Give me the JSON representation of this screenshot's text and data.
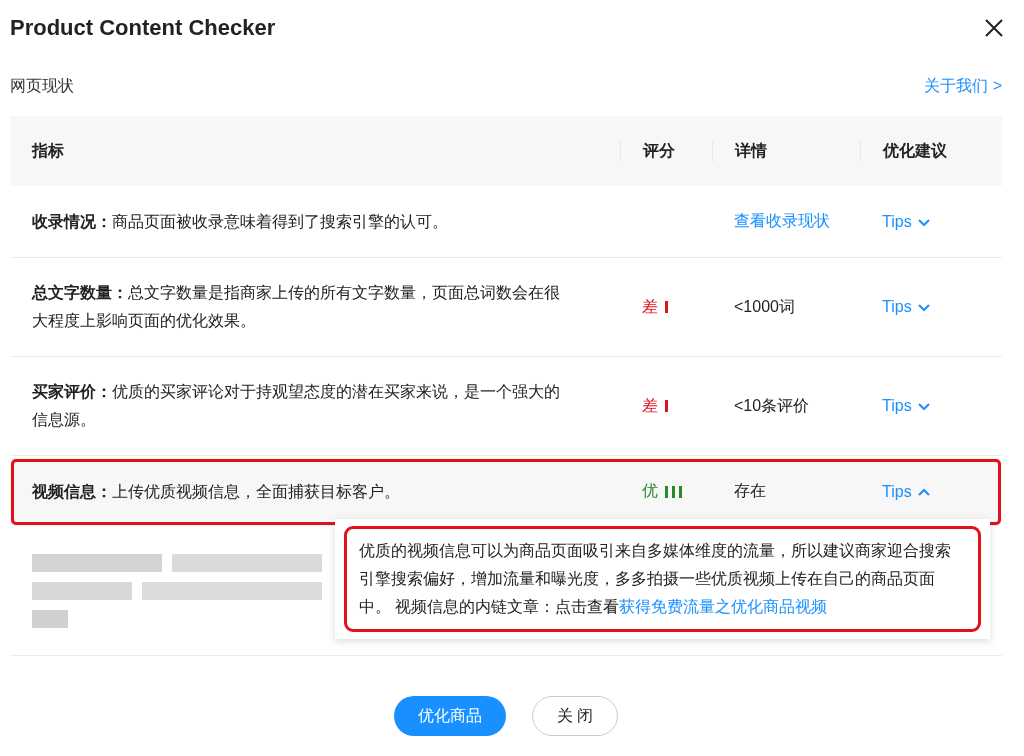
{
  "window": {
    "title": "Product Content Checker"
  },
  "section": {
    "title": "网页现状",
    "link": "关于我们 >"
  },
  "table": {
    "columns": [
      "指标",
      "评分",
      "详情",
      "优化建议"
    ],
    "rows": [
      {
        "name": "收录情况：",
        "description": "商品页面被收录意味着得到了搜索引擎的认可。",
        "detail": {
          "text": "查看收录现状",
          "kind": "link"
        },
        "tips": {
          "label": "Tips",
          "expanded": false
        },
        "highlighted": false
      },
      {
        "name": "总文字数量：",
        "description": "总文字数量是指商家上传的所有文字数量，页面总词数会在很大程度上影响页面的优化效果。",
        "score": {
          "label": "差",
          "kind": "poor"
        },
        "detail": {
          "text": "<1000词",
          "kind": "text"
        },
        "tips": {
          "label": "Tips",
          "expanded": false
        },
        "highlighted": false
      },
      {
        "name": "买家评价：",
        "description": "优质的买家评论对于持观望态度的潜在买家来说，是一个强大的信息源。",
        "score": {
          "label": "差",
          "kind": "poor"
        },
        "detail": {
          "text": "<10条评价",
          "kind": "text"
        },
        "tips": {
          "label": "Tips",
          "expanded": false
        },
        "highlighted": false
      },
      {
        "name": "视频信息：",
        "description": "上传优质视频信息，全面捕获目标客户。",
        "score": {
          "label": "优",
          "kind": "good"
        },
        "detail": {
          "text": "存在",
          "kind": "text"
        },
        "tips": {
          "label": "Tips",
          "expanded": true
        },
        "highlighted": true
      },
      {
        "kind": "blurred"
      }
    ]
  },
  "tip_popup": {
    "text": "优质的视频信息可以为商品页面吸引来自多媒体维度的流量，所以建议商家迎合搜索引擎搜索偏好，增加流量和曝光度，多多拍摄一些优质视频上传在自己的商品页面中。 视频信息的内链文章：点击查看",
    "link": "获得免费流量之优化商品视频",
    "highlighted": true
  },
  "buttons": [
    {
      "label": "优化商品",
      "kind": "primary"
    },
    {
      "label": "关 闭",
      "kind": "secondary"
    }
  ]
}
